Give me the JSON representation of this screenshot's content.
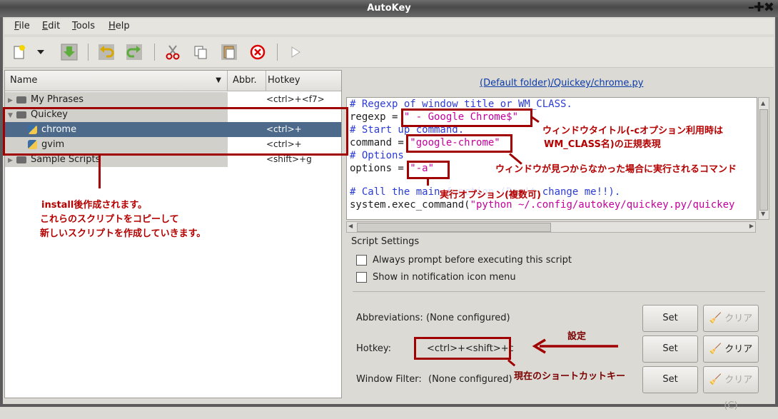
{
  "window": {
    "title": "AutoKey",
    "wm_buttons": "–✚✖"
  },
  "menu": [
    {
      "underline": "F",
      "rest": "ile"
    },
    {
      "underline": "E",
      "rest": "dit"
    },
    {
      "underline": "T",
      "rest": "ools"
    },
    {
      "underline": "H",
      "rest": "elp"
    }
  ],
  "toolbar": {
    "icons": [
      "new-icon",
      "dropdown-arrow-icon",
      "save-icon",
      "undo-icon",
      "redo-icon",
      "cut-icon",
      "copy-icon",
      "paste-icon",
      "delete-icon",
      "run-icon"
    ]
  },
  "tree": {
    "headers": {
      "name": "Name",
      "abbr": "Abbr.",
      "hotkey": "Hotkey"
    },
    "rows": [
      {
        "name": "My Phrases",
        "hotkey": "<ctrl>+<f7>",
        "type": "folder"
      },
      {
        "name": "Quickey",
        "hotkey": "",
        "type": "folder"
      },
      {
        "name": "chrome",
        "hotkey": "<ctrl>+<shift>+c",
        "type": "script"
      },
      {
        "name": "gvim",
        "hotkey": "<ctrl>+<shift>+g",
        "type": "script"
      },
      {
        "name": "Sample Scripts",
        "hotkey": "",
        "type": "folder"
      }
    ]
  },
  "path_link": "(Default folder)/Quickey/chrome.py",
  "code": {
    "l1": "# Regexp of window title or WM_CLASS.",
    "l2a": "regexp = ",
    "l2b": "\" - Google Chrome$\"",
    "l3": "# Start up command.",
    "l4a": "command = ",
    "l4b": "\"google-chrome\"",
    "l5": "# Options",
    "l6a": "options = ",
    "l6b": "\"-a\"",
    "l7": "# Call the main function (Don't change me!!).",
    "l8a": "system.exec_command(",
    "l8b": "\"python ~/.config/autokey/quickey.py/quickey"
  },
  "settings": {
    "title": "Script Settings",
    "always_prompt": "Always prompt before executing this script",
    "notification": "Show in notification icon menu",
    "abbr_label": "Abbreviations:",
    "abbr_value": "(None configured)",
    "hotkey_label": "Hotkey:",
    "hotkey_value": "<ctrl>+<shift>+c",
    "filter_label": "Window Filter:",
    "filter_value": "(None configured)",
    "set": "Set",
    "clear": "クリア(C)"
  },
  "annotations": {
    "install": "install後作成されます。",
    "copy1": "これらのスクリプトをコピーして",
    "copy2": "新しいスクリプトを作成していきます。",
    "regexp1": "ウィンドウタイトル(-cオプション利用時は",
    "regexp2": "WM_CLASS名)の正規表現",
    "command": "ウィンドウが見つからなかった場合に実行されるコマンド",
    "options": "実行オプション(複数可)",
    "settei": "設定",
    "current": "現在のショートカットキー"
  }
}
